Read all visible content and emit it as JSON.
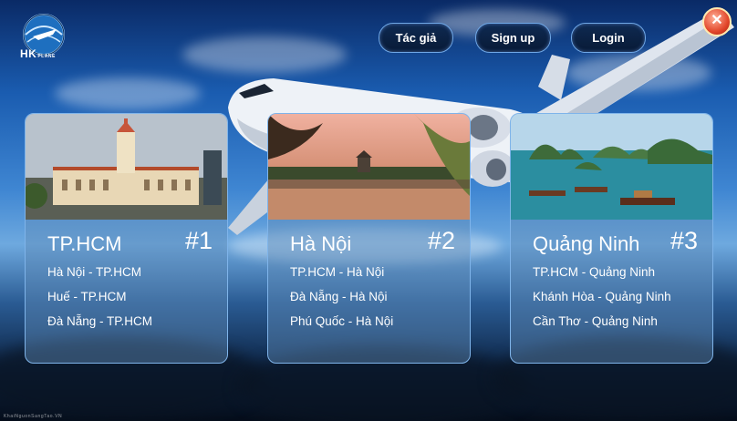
{
  "logo": {
    "text": "HK",
    "sub": "PLANE"
  },
  "nav": {
    "author_label": "Tác giả",
    "signup_label": "Sign up",
    "login_label": "Login"
  },
  "close_label": "✕",
  "cards": [
    {
      "city": "TP.HCM",
      "rank": "#1",
      "routes": [
        "Hà Nội - TP.HCM",
        "Huế - TP.HCM",
        "Đà Nẵng - TP.HCM"
      ]
    },
    {
      "city": "Hà Nội",
      "rank": "#2",
      "routes": [
        "TP.HCM - Hà Nội",
        "Đà Nẵng - Hà Nội",
        "Phú Quốc - Hà Nội"
      ]
    },
    {
      "city": "Quảng Ninh",
      "rank": "#3",
      "routes": [
        "TP.HCM - Quảng Ninh",
        "Khánh Hòa - Quảng Ninh",
        "Cần Thơ - Quảng Ninh"
      ]
    }
  ],
  "footer": "KhaiNguonSangTao.VN"
}
